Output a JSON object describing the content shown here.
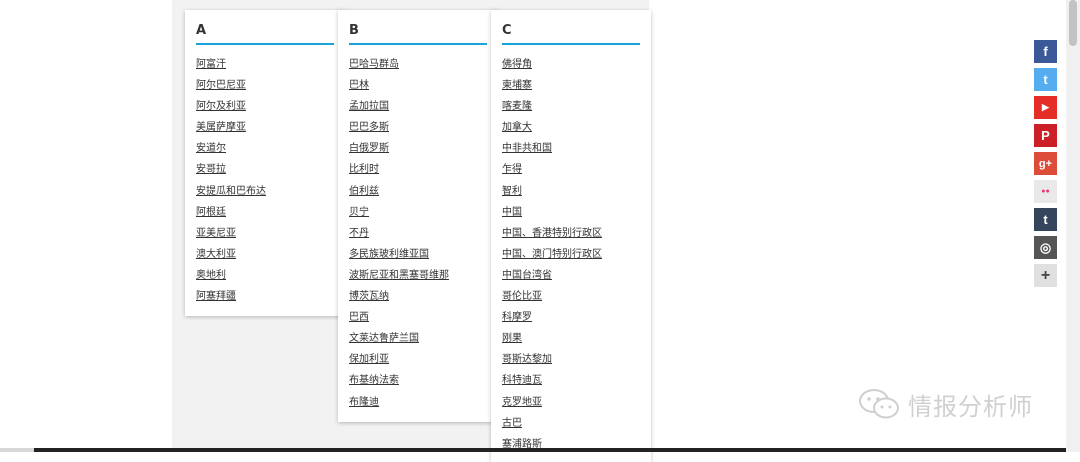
{
  "columns": [
    {
      "letter": "A",
      "countries": [
        "阿富汗",
        "阿尔巴尼亚",
        "阿尔及利亚",
        "美属萨摩亚",
        "安道尔",
        "安哥拉",
        "安提瓜和巴布达",
        "阿根廷",
        "亚美尼亚",
        "澳大利亚",
        "奥地利",
        "阿塞拜疆"
      ]
    },
    {
      "letter": "B",
      "countries": [
        "巴哈马群岛",
        "巴林",
        "孟加拉国",
        "巴巴多斯",
        "白俄罗斯",
        "比利时",
        "伯利兹",
        "贝宁",
        "不丹",
        "多民族玻利维亚国",
        "波斯尼亚和黑塞哥维那",
        "博茨瓦纳",
        "巴西",
        "文莱达鲁萨兰国",
        "保加利亚",
        "布基纳法索",
        "布隆迪"
      ]
    },
    {
      "letter": "C",
      "countries": [
        "佛得角",
        "柬埔寨",
        "喀麦隆",
        "加拿大",
        "中非共和国",
        "乍得",
        "智利",
        "中国",
        "中国、香港特别行政区",
        "中国、澳门特别行政区",
        "中国台湾省",
        "哥伦比亚",
        "科摩罗",
        "刚果",
        "哥斯达黎加",
        "科特迪瓦",
        "克罗地亚",
        "古巴",
        "塞浦路斯"
      ]
    }
  ],
  "social": [
    {
      "name": "facebook-icon",
      "glyph": "f",
      "color": "#3b5998"
    },
    {
      "name": "twitter-icon",
      "glyph": "t",
      "color": "#55acee"
    },
    {
      "name": "youtube-icon",
      "glyph": "▶",
      "color": "#e52d27"
    },
    {
      "name": "pinterest-icon",
      "glyph": "P",
      "color": "#cb2027"
    },
    {
      "name": "google-plus-icon",
      "glyph": "g+",
      "color": "#dd4b39"
    },
    {
      "name": "flickr-icon",
      "glyph": "●●",
      "color": "#e9e9e9"
    },
    {
      "name": "tumblr-icon",
      "glyph": "t",
      "color": "#35465c"
    },
    {
      "name": "instagram-icon",
      "glyph": "◎",
      "color": "#555555"
    },
    {
      "name": "more-icon",
      "glyph": "+",
      "color": "#e0e0e0"
    }
  ],
  "watermark": {
    "text": "情报分析师"
  }
}
